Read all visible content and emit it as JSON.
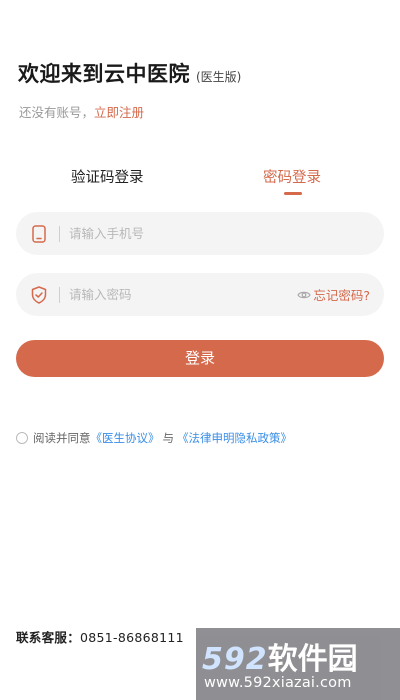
{
  "header": {
    "title": "欢迎来到云中医院",
    "title_tag": "(医生版)",
    "register_prompt": "还没有账号，",
    "register_link": "立即注册"
  },
  "tabs": [
    {
      "label": "验证码登录",
      "active": false
    },
    {
      "label": "密码登录",
      "active": true
    }
  ],
  "form": {
    "phone": {
      "placeholder": "请输入手机号",
      "value": "",
      "icon": "phone-icon"
    },
    "password": {
      "placeholder": "请输入密码",
      "value": "",
      "icon": "shield-icon"
    },
    "forgot_label": "忘记密码?",
    "login_label": "登录"
  },
  "agreement": {
    "prefix": "阅读并同意",
    "doctor_agreement": "《医生协议》",
    "and": "与",
    "privacy_policy": "《法律申明隐私政策》",
    "checked": false
  },
  "footer": {
    "hotline_label": "联系客服：",
    "hotline_number": "0851-86868111"
  },
  "watermark": {
    "logo_num": "592",
    "logo_cn": "软件园",
    "url": "www.592xiazai.com"
  },
  "colors": {
    "accent": "#d5694c",
    "link": "#3a8ee6",
    "field_bg": "#f4f4f4"
  }
}
